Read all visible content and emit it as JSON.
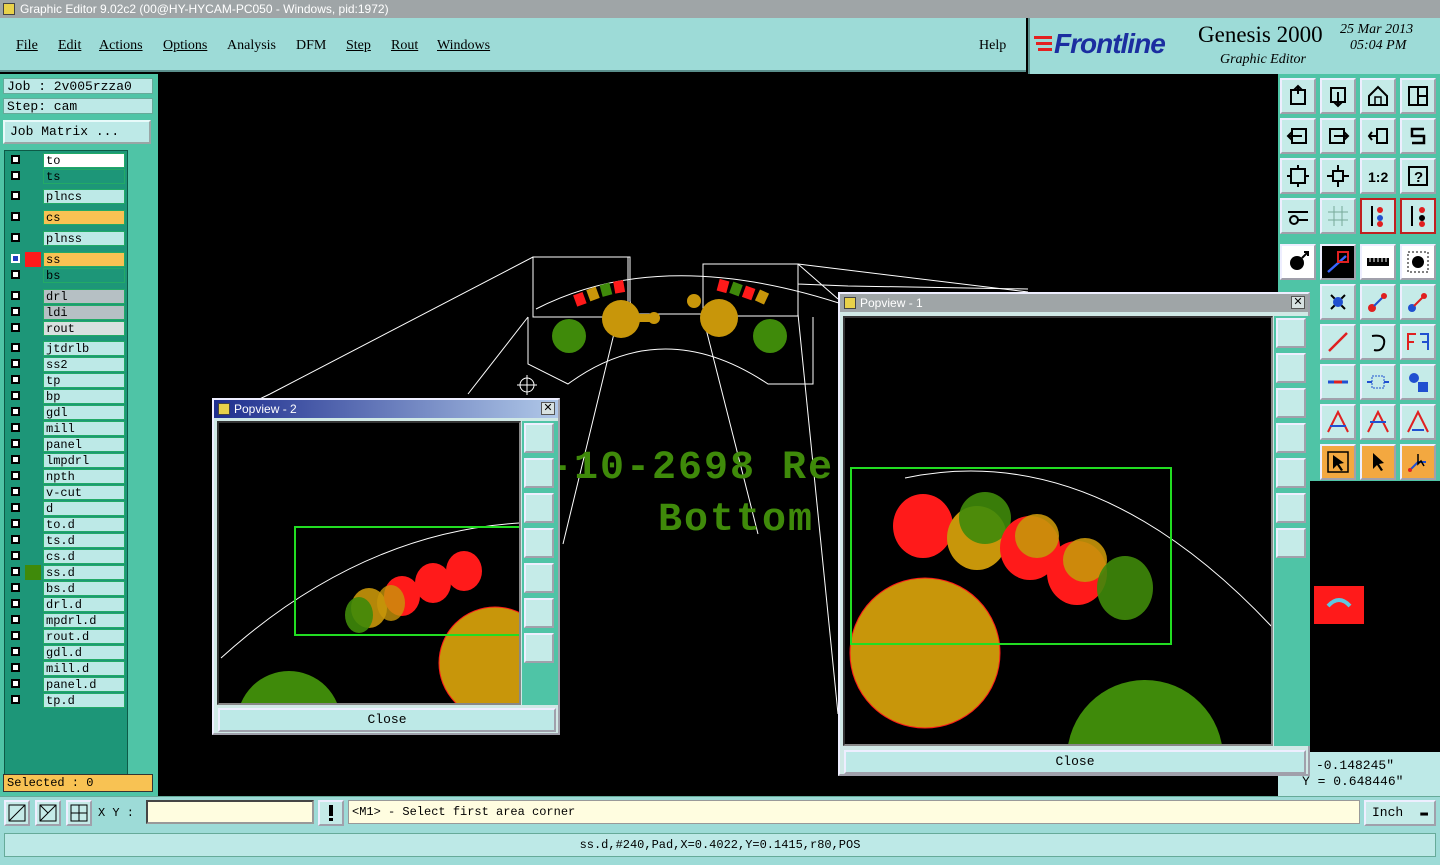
{
  "window": {
    "title": "Graphic Editor 9.02c2 (00@HY-HYCAM-PC050 - Windows, pid:1972)"
  },
  "menu": {
    "items": [
      "File",
      "Edit",
      "Actions",
      "Options",
      "Analysis",
      "DFM",
      "Step",
      "Rout",
      "Windows"
    ],
    "help": "Help"
  },
  "brand": {
    "logo": "Frontline",
    "product": "Genesis 2000",
    "subtitle": "Graphic Editor",
    "date": "25 Mar 2013",
    "time": "05:04 PM"
  },
  "job": {
    "job_line": "Job : 2v005rzza0",
    "step_line": "Step: cam",
    "matrix_button": "Job Matrix ..."
  },
  "layers": [
    {
      "name": "to",
      "color": "#ffffff"
    },
    {
      "name": "ts",
      "color": "#1d9678"
    },
    {
      "name": "plncs",
      "color": "#bde9e7"
    },
    {
      "name": "cs",
      "color": "#f8c253"
    },
    {
      "name": "plnss",
      "color": "#bde9e7"
    },
    {
      "name": "ss",
      "color": "#f8c253"
    },
    {
      "name": "bs",
      "color": "#1d9678"
    },
    {
      "name": "drl",
      "color": "#b6c0c4"
    },
    {
      "name": "ldi",
      "color": "#b6c0c4"
    },
    {
      "name": "rout",
      "color": "#d9e0e0"
    },
    {
      "name": "jtdrlb",
      "color": "#bde9e7"
    },
    {
      "name": "ss2",
      "color": "#bde9e7"
    },
    {
      "name": "tp",
      "color": "#bde9e7"
    },
    {
      "name": "bp",
      "color": "#bde9e7"
    },
    {
      "name": "gdl",
      "color": "#bde9e7"
    },
    {
      "name": "mill",
      "color": "#bde9e7"
    },
    {
      "name": "panel",
      "color": "#bde9e7"
    },
    {
      "name": "lmpdrl",
      "color": "#bde9e7"
    },
    {
      "name": "npth",
      "color": "#bde9e7"
    },
    {
      "name": "v-cut",
      "color": "#bde9e7"
    },
    {
      "name": "d",
      "color": "#bde9e7"
    },
    {
      "name": "to.d",
      "color": "#bde9e7"
    },
    {
      "name": "ts.d",
      "color": "#bde9e7"
    },
    {
      "name": "cs.d",
      "color": "#bde9e7"
    },
    {
      "name": "ss.d",
      "color": "#bde9e7"
    },
    {
      "name": "bs.d",
      "color": "#bde9e7"
    },
    {
      "name": "drl.d",
      "color": "#bde9e7"
    },
    {
      "name": "mpdrl.d",
      "color": "#bde9e7"
    },
    {
      "name": "rout.d",
      "color": "#bde9e7"
    },
    {
      "name": "gdl.d",
      "color": "#bde9e7"
    },
    {
      "name": "mill.d",
      "color": "#bde9e7"
    },
    {
      "name": "panel.d",
      "color": "#bde9e7"
    },
    {
      "name": "tp.d",
      "color": "#bde9e7"
    }
  ],
  "selected_text": "Selected : 0",
  "canvas": {
    "text_line1": "-10-2698 Re",
    "text_line2": "Bottom Si"
  },
  "popview1": {
    "title": "Popview - 1",
    "close_label": "Close"
  },
  "popview2": {
    "title": "Popview - 2",
    "close_label": "Close"
  },
  "coords": {
    "x": "-0.148245\"",
    "y": "Y = 0.648446\""
  },
  "command": {
    "xy_label": "X Y :",
    "xy_value": "",
    "prompt": "<M1> - Select first area corner",
    "unit": "Inch"
  },
  "status": "ss.d,#240,Pad,X=0.4022,Y=0.1415,r80,POS",
  "colors": {
    "panel_teal": "#9ddbd7",
    "layer_green": "#1d9678",
    "pad_gold": "#c8960a",
    "pad_green": "#3f8a0a",
    "silk_red": "#ff1a1a",
    "selection_green": "#22dd22"
  }
}
